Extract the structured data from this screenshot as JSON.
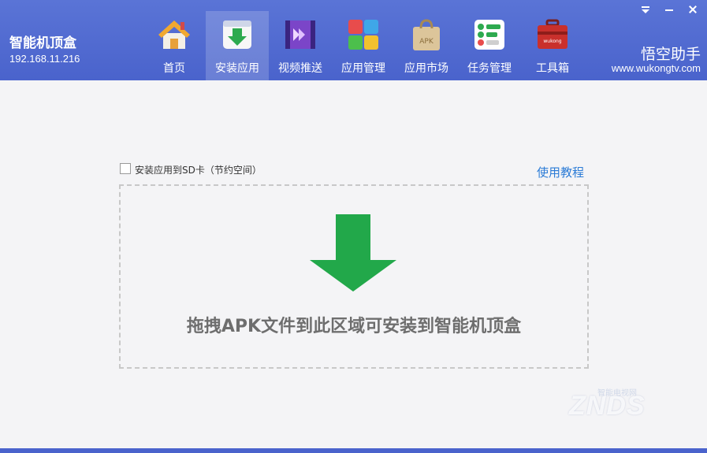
{
  "header": {
    "device_name": "智能机顶盒",
    "device_ip": "192.168.11.216",
    "brand_title": "悟空助手",
    "brand_url": "www.wukongtv.com"
  },
  "window_controls": [
    "dropdown-icon",
    "minimize-icon",
    "close-icon"
  ],
  "nav": {
    "active_index": 1,
    "items": [
      {
        "label": "首页",
        "icon": "home-icon"
      },
      {
        "label": "安装应用",
        "icon": "install-download-icon"
      },
      {
        "label": "视频推送",
        "icon": "video-push-icon"
      },
      {
        "label": "应用管理",
        "icon": "app-manage-icon"
      },
      {
        "label": "应用市场",
        "icon": "apk-market-bag-icon"
      },
      {
        "label": "任务管理",
        "icon": "task-manage-icon"
      },
      {
        "label": "工具箱",
        "icon": "toolbox-icon"
      }
    ],
    "toolbox_badge": "wukong"
  },
  "install": {
    "sd_checkbox_label": "安装应用到SD卡（节约空间）",
    "sd_checked": false,
    "help_link": "使用教程",
    "drop_text": "拖拽APK文件到此区域可安装到智能机顶盒",
    "arrow_color": "#22a84a"
  },
  "watermark": {
    "text": "ZNDS",
    "sub": "智能电视网"
  },
  "colors": {
    "header_bg": "#4a63cc",
    "accent_green": "#22a84a",
    "link_blue": "#2b7bd6"
  }
}
